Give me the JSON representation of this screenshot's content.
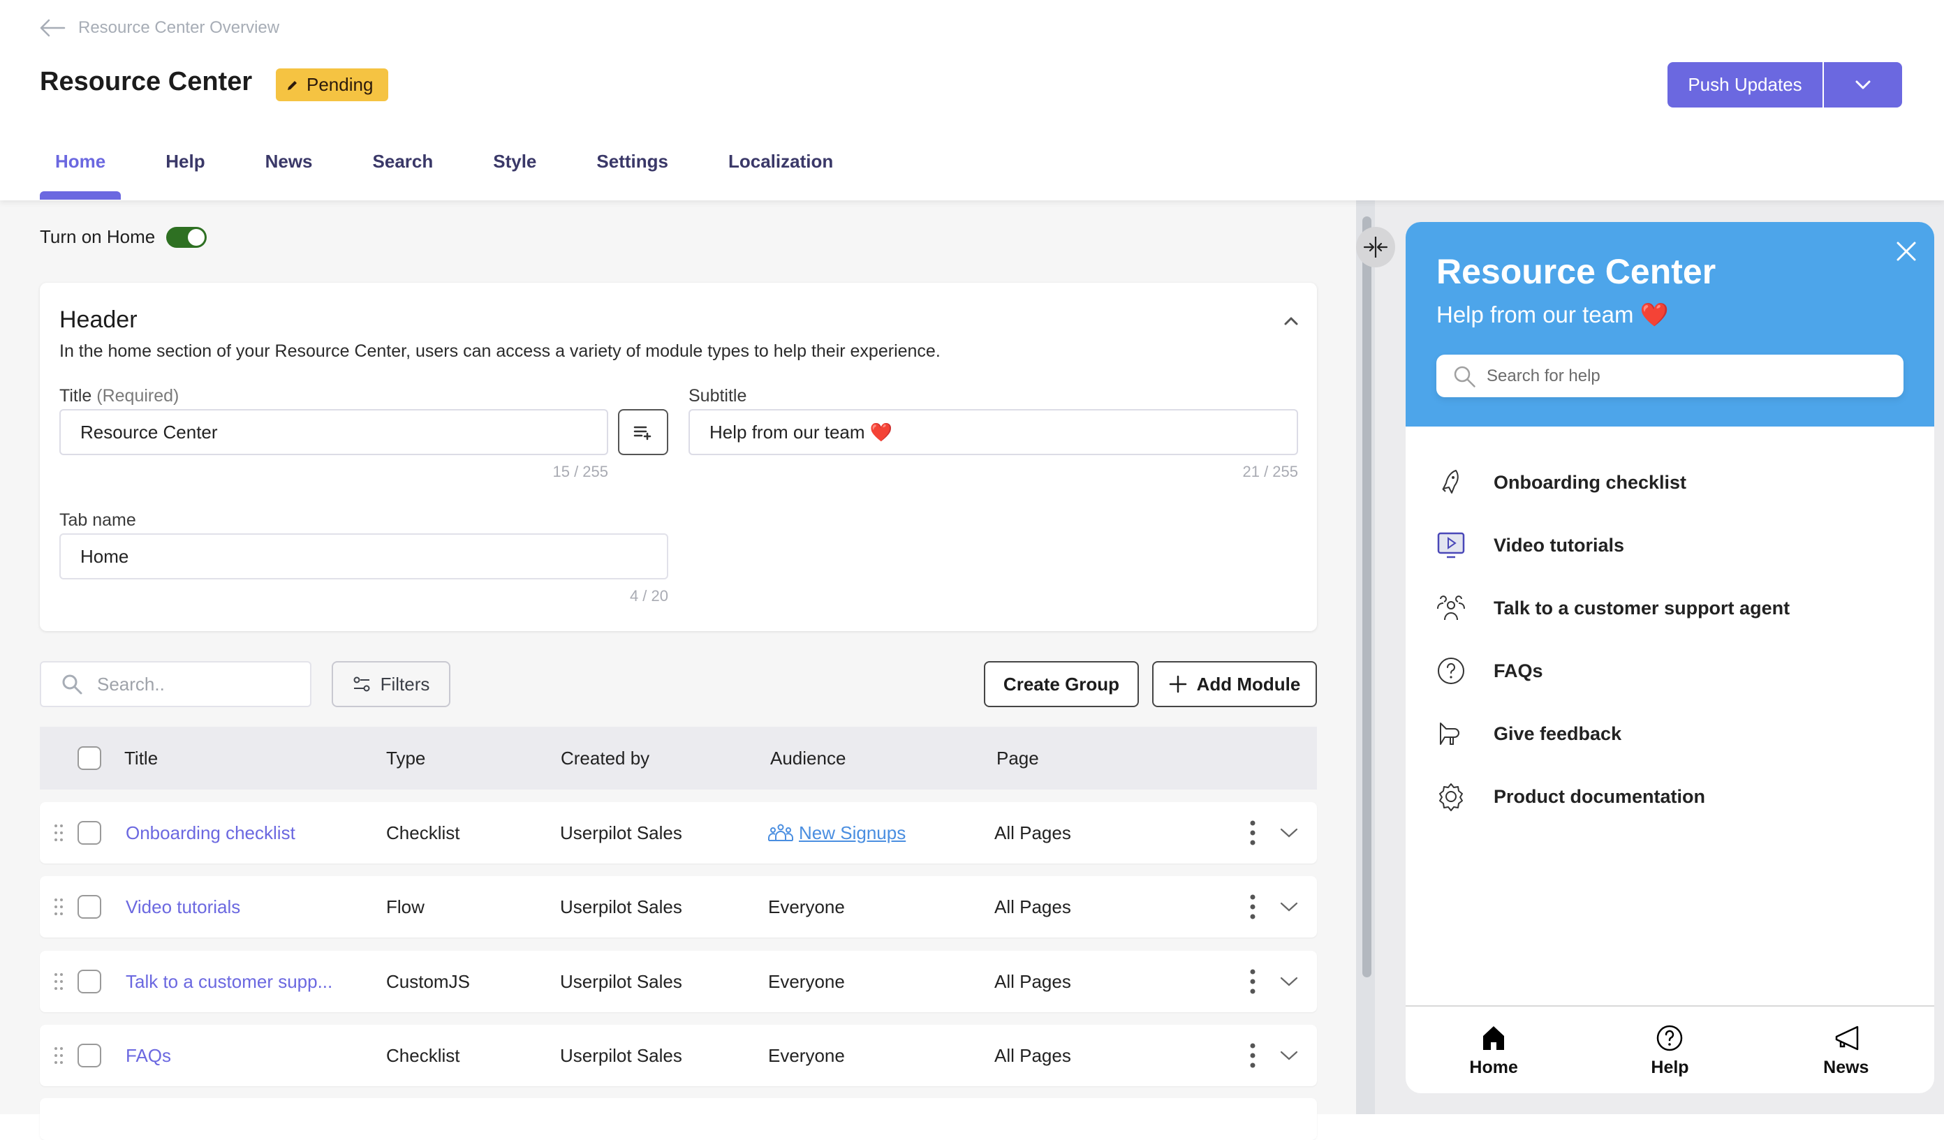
{
  "breadcrumb": {
    "label": "Resource Center Overview"
  },
  "header": {
    "title": "Resource Center",
    "status_badge": "Pending",
    "push_button": "Push Updates"
  },
  "tabs": [
    {
      "label": "Home",
      "active": true
    },
    {
      "label": "Help"
    },
    {
      "label": "News"
    },
    {
      "label": "Search"
    },
    {
      "label": "Style"
    },
    {
      "label": "Settings"
    },
    {
      "label": "Localization"
    }
  ],
  "home_toggle": {
    "label": "Turn on Home",
    "on": true
  },
  "header_card": {
    "heading": "Header",
    "description": "In the home section of your Resource Center, users can access a variety of module types to help their experience.",
    "title_label": "Title",
    "title_required": "(Required)",
    "title_value": "Resource Center",
    "title_counter": "15 / 255",
    "subtitle_label": "Subtitle",
    "subtitle_value": "Help from our team ❤️",
    "subtitle_counter": "21 / 255",
    "tabname_label": "Tab name",
    "tabname_value": "Home",
    "tabname_counter": "4 / 20"
  },
  "toolbar": {
    "search_placeholder": "Search..",
    "filters_label": "Filters",
    "create_group_label": "Create Group",
    "add_module_label": "Add Module"
  },
  "table": {
    "columns": [
      "Title",
      "Type",
      "Created by",
      "Audience",
      "Page"
    ],
    "rows": [
      {
        "title": "Onboarding checklist",
        "type": "Checklist",
        "created_by": "Userpilot Sales",
        "audience": "New Signups",
        "audience_is_segment": true,
        "page": "All Pages"
      },
      {
        "title": "Video tutorials",
        "type": "Flow",
        "created_by": "Userpilot Sales",
        "audience": "Everyone",
        "page": "All Pages"
      },
      {
        "title": "Talk to a customer supp...",
        "type": "CustomJS",
        "created_by": "Userpilot Sales",
        "audience": "Everyone",
        "page": "All Pages"
      },
      {
        "title": "FAQs",
        "type": "Checklist",
        "created_by": "Userpilot Sales",
        "audience": "Everyone",
        "page": "All Pages"
      }
    ]
  },
  "preview": {
    "title": "Resource Center",
    "subtitle": "Help from our team ❤️",
    "search_placeholder": "Search for help",
    "items": [
      {
        "label": "Onboarding checklist",
        "icon": "rocket-icon"
      },
      {
        "label": "Video tutorials",
        "icon": "video-play-icon"
      },
      {
        "label": "Talk to a customer support agent",
        "icon": "people-icon"
      },
      {
        "label": "FAQs",
        "icon": "question-circle-icon"
      },
      {
        "label": "Give feedback",
        "icon": "megaphone-icon"
      },
      {
        "label": "Product documentation",
        "icon": "gear-icon"
      }
    ],
    "footer_tabs": [
      {
        "label": "Home",
        "icon": "home-icon"
      },
      {
        "label": "Help",
        "icon": "question-circle-icon"
      },
      {
        "label": "News",
        "icon": "megaphone-icon"
      }
    ],
    "header_color": "#4da5ea"
  },
  "colors": {
    "accent": "#6b68e0",
    "badge": "#f5c342",
    "toggle_on": "#2e7022",
    "link": "#4a8ee0"
  }
}
